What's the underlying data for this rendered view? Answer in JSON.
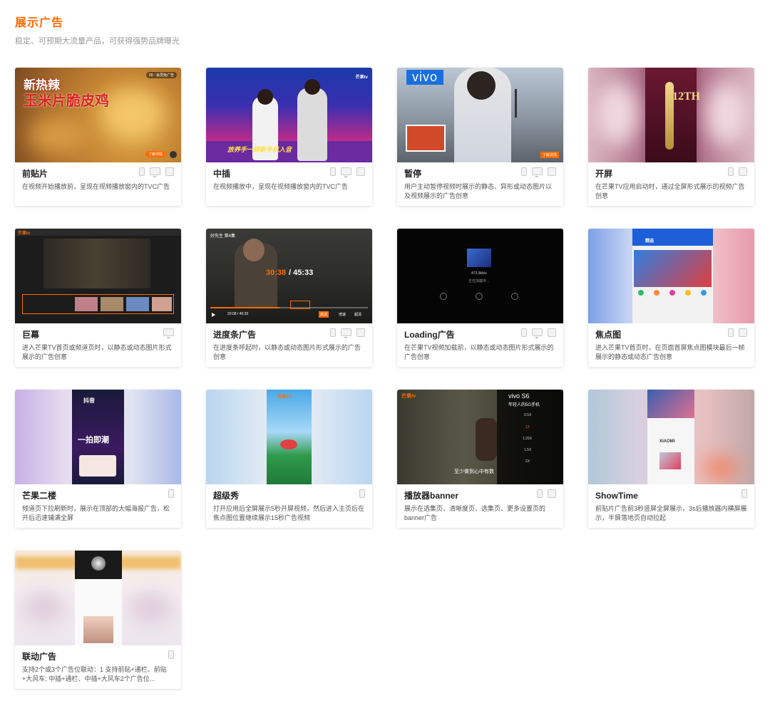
{
  "section": {
    "title": "展示广告",
    "subtitle": "稳定、可预期大流量产品，可获得强势品牌曝光"
  },
  "cards": [
    {
      "name": "前贴片",
      "desc": "在视频开始播放前，呈现在视频播放窗内的TVC广告",
      "devices": [
        "phone",
        "tv",
        "pad"
      ],
      "thumb_text": [
        "新热辣",
        "玉米片脆皮鸡",
        "09 · 会员免广告",
        "了解详情"
      ]
    },
    {
      "name": "中插",
      "desc": "在视频播放中，呈现在视频播放窗内的TVC广告",
      "devices": [
        "phone",
        "tv",
        "pad"
      ],
      "thumb_text": [
        "芒果tv",
        "放养手一群新手机入音"
      ]
    },
    {
      "name": "暂停",
      "desc": "用户主动暂停视频时展示的静态、异形或动态图片以及视频展示的广告创意",
      "devices": [
        "phone",
        "tv",
        "pad"
      ],
      "thumb_text": [
        "vivo",
        "了解详情"
      ]
    },
    {
      "name": "开屏",
      "desc": "在芒果TV应用启动时，通过全屏形式展示的视频广告创意",
      "devices": [
        "phone",
        "pad"
      ],
      "thumb_text": [
        "12TH"
      ]
    },
    {
      "name": "巨幕",
      "desc": "进入芒果TV首页或频道页时，以静态或动态图片形式展示的广告创意",
      "devices": [
        "tv"
      ],
      "thumb_text": [
        "芒果tv"
      ]
    },
    {
      "name": "进度条广告",
      "desc": "在进度条呼起时，以静态或动态图片形式展示的广告创意",
      "devices": [
        "phone",
        "tv",
        "pad"
      ],
      "thumb_text": [
        "好先生 第4集",
        "30:38",
        "/ 45:33",
        "20:08 / 45:33",
        "高清",
        "倍速",
        "超清"
      ]
    },
    {
      "name": "Loading广告",
      "desc": "在芒果TV视频加载前，以静态或动态图片形式展示的广告创意",
      "devices": [
        "phone",
        "tv",
        "pad"
      ],
      "thumb_text": [
        "473.9kb/s",
        "正在加载中..."
      ]
    },
    {
      "name": "焦点图",
      "desc": "进入芒果TV首页时，在页面首屏焦点图模块最后一帧展示的静态或动态广告创意",
      "devices": [
        "phone",
        "pad"
      ],
      "thumb_text": [
        "精选"
      ]
    },
    {
      "name": "芒果二楼",
      "desc": "频道页下拉刷新时，展示在顶部的大幅海报广告，松开后迅速铺满全屏",
      "devices": [
        "phone"
      ],
      "thumb_text": [
        "抖音",
        "一拍即潮"
      ]
    },
    {
      "name": "超级秀",
      "desc": "打开应用后全屏展示5秒开屏视频，然后进入主页后在焦点图位置继续展示15秒广告视频",
      "devices": [
        "phone"
      ],
      "thumb_text": [
        "芒果TV"
      ]
    },
    {
      "name": "播放器banner",
      "desc": "展示在选集页、清晰度页、选集页、更多设置页的banner广告",
      "devices": [
        "phone",
        "pad"
      ],
      "thumb_text": [
        "芒果tv",
        "vivo S6",
        "年轻人的5G手机",
        "0.5X",
        "1X",
        "1.25X",
        "1.5X",
        "2X",
        "至少做到心中有数"
      ]
    },
    {
      "name": "ShowTime",
      "desc": "前贴片广告前3秒竖屏全屏展示，3s后播放器内横屏展示，半屏落地页自动拉起",
      "devices": [
        "phone"
      ],
      "thumb_text": [
        "XIAOMI"
      ]
    },
    {
      "name": "联动广告",
      "desc": "支持2个或3个广告位联动：1 支持前贴+通栏、前贴+大风车; 中插+通栏、中插+大风车2个广告位...",
      "devices": [
        "phone"
      ],
      "thumb_text": []
    }
  ],
  "colors": {
    "accent": "#ff6a00",
    "card_text": "#222222",
    "desc_text": "#555555",
    "subtitle_text": "#999999"
  }
}
